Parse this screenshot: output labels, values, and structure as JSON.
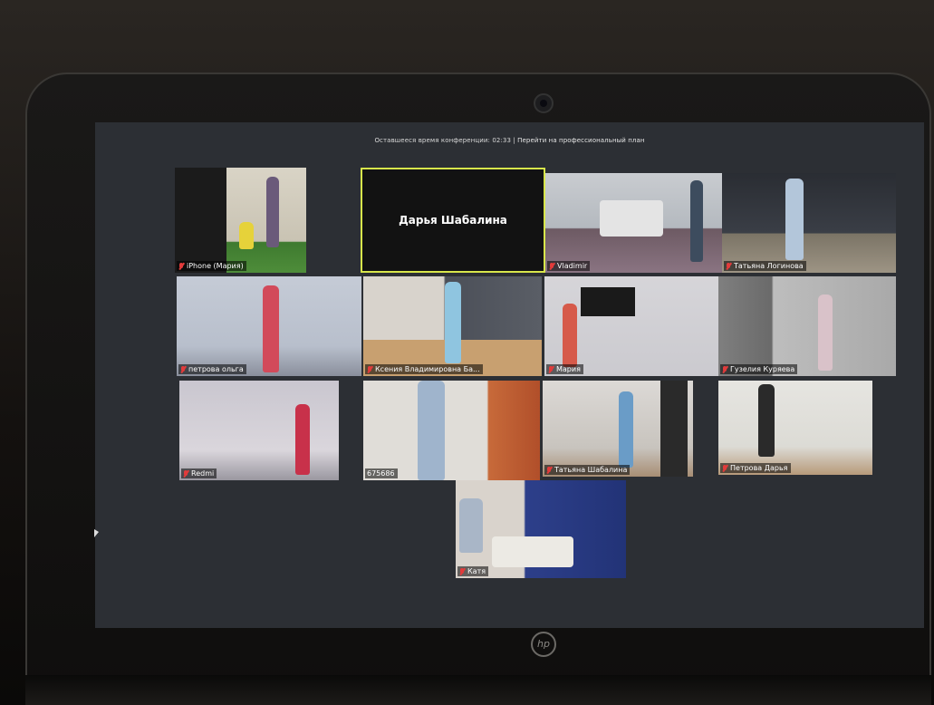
{
  "banner": {
    "time_label": "Оставшееся время конференции: 02:33",
    "separator": "|",
    "upgrade_link": "Перейти на профессиональный план"
  },
  "tiles": [
    {
      "name": "iPhone (Мария)"
    },
    {
      "name": "Дарья Шабалина",
      "active_speaker": true,
      "video_off": true
    },
    {
      "name": "Vladimir"
    },
    {
      "name": "Татьяна Логинова"
    },
    {
      "name": "петрова ольга"
    },
    {
      "name": "Ксения Владимировна Ба..."
    },
    {
      "name": "Мария"
    },
    {
      "name": "Гузелия Куряева"
    },
    {
      "name": "Redmi"
    },
    {
      "name": "675686"
    },
    {
      "name": "Татьяна Шабалина"
    },
    {
      "name": "Петрова Дарья"
    },
    {
      "name": "Катя"
    }
  ],
  "colors": {
    "active_speaker_border": "#d8e64b",
    "muted_mic": "#e23b3b",
    "screen_bg": "#2c2f34"
  },
  "icons": {
    "muted": "mic-muted-icon",
    "brand": "hp-logo-icon"
  },
  "brand": {
    "logo_text": "hp"
  }
}
